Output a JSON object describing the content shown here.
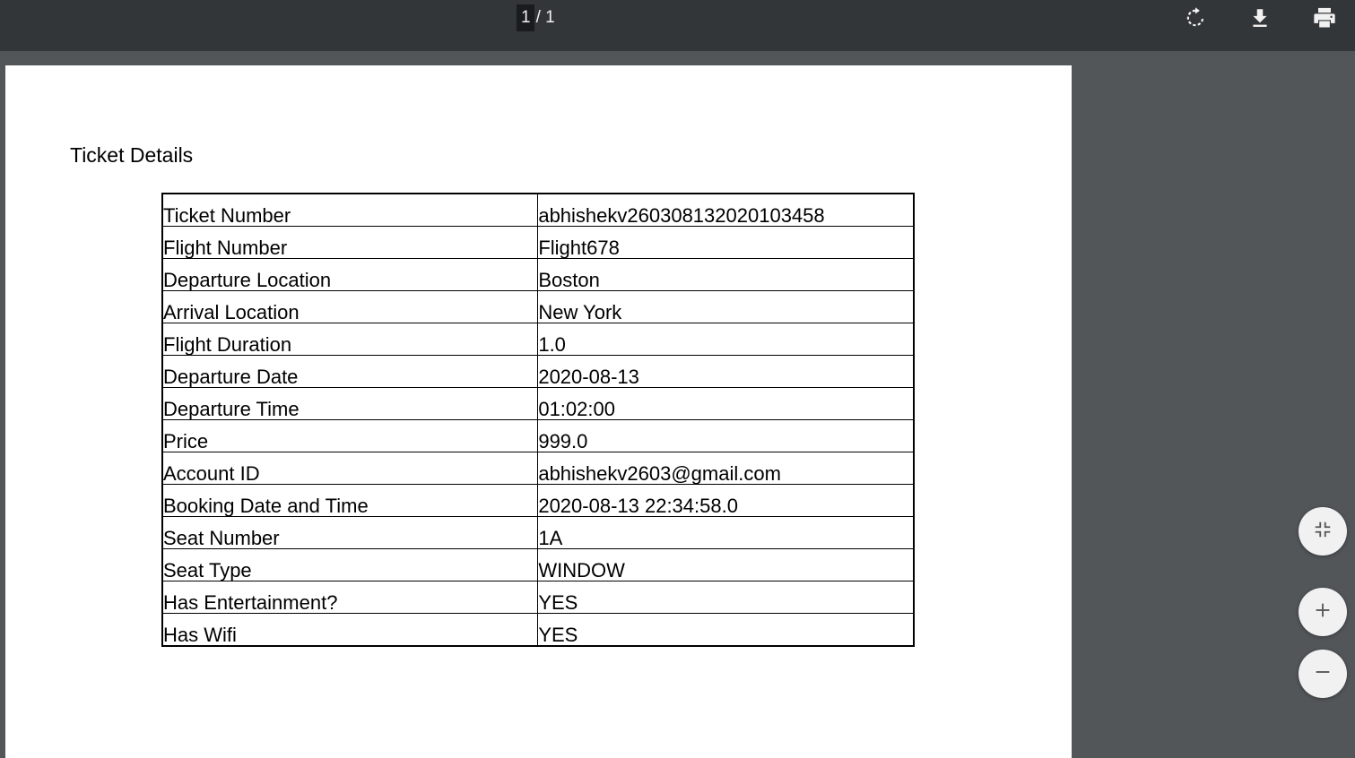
{
  "toolbar": {
    "page_current": "1",
    "page_total_text": "/ 1",
    "icons": [
      "rotate-icon",
      "download-icon",
      "print-icon"
    ]
  },
  "document": {
    "title": "Ticket Details",
    "rows": [
      {
        "label": "Ticket Number",
        "value": "abhishekv260308132020103458"
      },
      {
        "label": "Flight Number",
        "value": "Flight678"
      },
      {
        "label": "Departure Location",
        "value": "Boston"
      },
      {
        "label": "Arrival Location",
        "value": "New York"
      },
      {
        "label": "Flight Duration",
        "value": "1.0"
      },
      {
        "label": "Departure Date",
        "value": "2020-08-13"
      },
      {
        "label": "Departure Time",
        "value": "01:02:00"
      },
      {
        "label": "Price",
        "value": "999.0"
      },
      {
        "label": "Account ID",
        "value": "abhishekv2603@gmail.com"
      },
      {
        "label": "Booking Date and Time",
        "value": "2020-08-13 22:34:58.0"
      },
      {
        "label": "Seat Number",
        "value": "1A"
      },
      {
        "label": "Seat Type",
        "value": "WINDOW"
      },
      {
        "label": "Has Entertainment?",
        "value": "YES"
      },
      {
        "label": "Has Wifi",
        "value": "YES"
      }
    ]
  },
  "zoom_controls": {
    "icons": [
      "fit-page-icon",
      "zoom-in-icon",
      "zoom-out-icon"
    ]
  },
  "colors": {
    "toolbar_bg": "#323639",
    "viewer_bg": "#525659",
    "page_bg": "#ffffff",
    "fab_bg": "#f1f1f1"
  }
}
